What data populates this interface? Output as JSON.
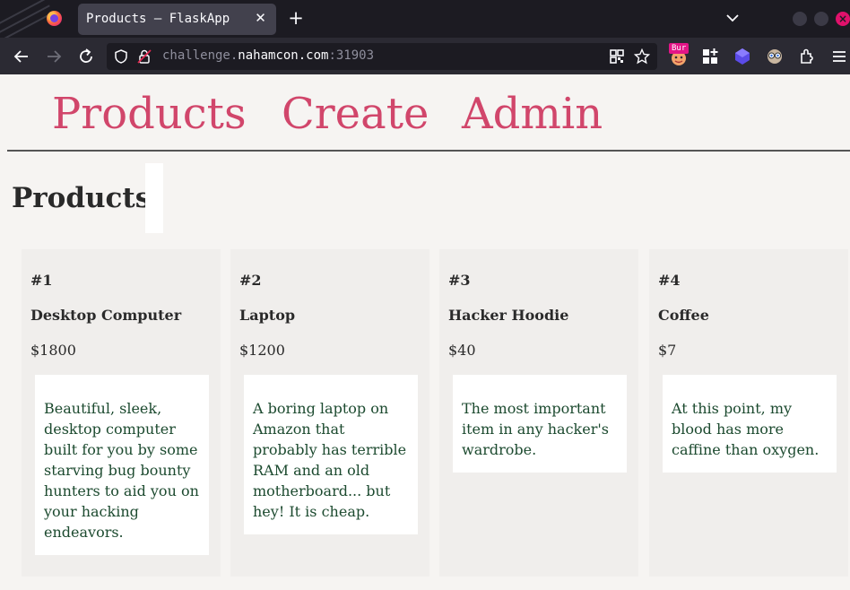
{
  "browser": {
    "tab_title": "Products – FlaskApp",
    "url_prefix": "challenge.",
    "url_host": "nahamcon.com",
    "url_port": ":31903",
    "burp_badge": "Bur",
    "accent": "#e31587"
  },
  "site_nav": {
    "links": [
      {
        "label": "Products"
      },
      {
        "label": "Create"
      },
      {
        "label": "Admin"
      }
    ],
    "link_color": "#d1466b"
  },
  "page": {
    "title": "Products"
  },
  "products": [
    {
      "id": "#1",
      "name": "Desktop Computer",
      "price": "$1800",
      "description": "Beautiful, sleek, desktop computer built for you by some starving bug bounty hunters to aid you on your hacking endeavors."
    },
    {
      "id": "#2",
      "name": "Laptop",
      "price": "$1200",
      "description": "A boring laptop on Amazon that probably has terrible RAM and an old motherboard... but hey! It is cheap."
    },
    {
      "id": "#3",
      "name": "Hacker Hoodie",
      "price": "$40",
      "description": "The most important item in any hacker's wardrobe."
    },
    {
      "id": "#4",
      "name": "Coffee",
      "price": "$7",
      "description": "At this point, my blood has more caffine than oxygen."
    }
  ],
  "icons": {
    "browser": [
      "firefox-logo-icon",
      "close-tab-icon",
      "new-tab-icon",
      "tab-list-chevron-icon",
      "back-arrow-icon",
      "forward-arrow-icon",
      "reload-icon",
      "tracking-shield-icon",
      "insecure-lock-icon",
      "qr-code-icon",
      "bookmark-star-icon",
      "burp-extension-icon",
      "add-grid-extension-icon",
      "purple-cube-extension-icon",
      "wappalyzer-extension-icon",
      "extensions-puzzle-icon",
      "app-menu-icon"
    ]
  }
}
